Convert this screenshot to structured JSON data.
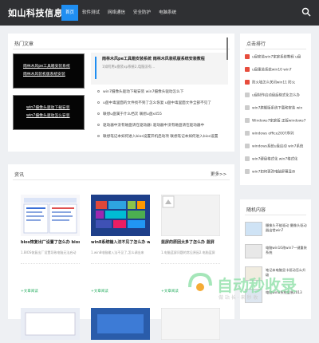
{
  "site": {
    "logo": "如山科技信息网"
  },
  "nav": {
    "items": [
      "首页",
      "软件测试",
      "网络通信",
      "安全防护",
      "电脑系统"
    ],
    "active_index": 0
  },
  "hot": {
    "title": "热门文章",
    "thumbs": [
      {
        "line1": "雨林木风pe工具箱安装系统",
        "line2": "雨林木风装机版系统安装"
      },
      {
        "line1": "win7摄像头驱动下载安装",
        "line2": "win7摄像头驱动怎么安装"
      }
    ],
    "featured": {
      "title": "雨林木风pe工具箱安装系统 雨林木风装机版系统安装教程",
      "desc": "1如何用u盘装xp系统2,电脑没有..."
    },
    "list": [
      "win7摄像头驱动下载安装 win7摄像头驱动怎么下",
      "u盘中毒里面的文件找不到了怎么恢复 u盘中毒里面文件全部不见了",
      "联想u盘属于什么档次 联想u盘x455",
      "驱动器中没有磁盘请在驱动器\\ 驱动器中没有磁盘请在驱动器中",
      "联想笔记本如何进入bios设置开机启动项 联想笔记本如何进入bios设置"
    ]
  },
  "ranking": {
    "title": "点击排行",
    "items": [
      "u盘安装win7家庭系统教程 u盘",
      "u盘重装系统win10 win7",
      "防火墙怎么关闭win11 防火",
      "u盘制作启动盘后格式化怎么办",
      "win7旗舰版系统下载和安装 win",
      "Windows7家庭版 正版windows7",
      "windows office2007序列",
      "windows系统u盘启动 win7系统",
      "win7硬盘格式化 win7格式化",
      "win7如何更改电脑屏幕显示"
    ]
  },
  "news": {
    "title": "资讯",
    "more": "更多>>",
    "cards": [
      {
        "title": "bios恢复出厂设置了怎么办 bios",
        "desc": "1.BIOS恢复出厂设置导致电脑无法启动",
        "read": "+文章阅读"
      },
      {
        "title": "win8系统输入法不见了怎么办 win8",
        "desc": "1.win8电脑输入法不见了,怎么调出来",
        "read": "+文章阅读"
      },
      {
        "title": "蓝屏的原因太多了怎么办 蓝屏",
        "desc": "1.电脑蓝屏问题的常见原因2.电脑蓝屏",
        "read": "+文章阅读"
      }
    ]
  },
  "side2": {
    "title": "随机内容",
    "items": [
      "摄像头不能驱动 摄像头驱动器出错win7",
      "电脑win10改win7一键重装系统",
      "笔记本电脑显卡驱动怎么升级",
      "电脑win8系统重装2013"
    ]
  },
  "watermark": {
    "text": "自动秒收录",
    "sub": "做 站 长 · 来 秒 收"
  },
  "colors": {
    "accent": "#1f8ef1",
    "topbar": "#2f3033",
    "read": "#27ae60"
  }
}
